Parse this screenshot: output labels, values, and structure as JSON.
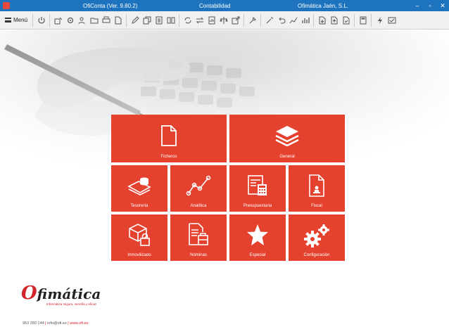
{
  "titlebar": {
    "app": "OfiConta (Ver. 9.80.2)",
    "section": "Contabilidad",
    "company": "Ofimática Jaén, S.L.",
    "min": "–",
    "max": "▫",
    "close": "✕"
  },
  "toolbar": {
    "menu_label": "Menú"
  },
  "tiles": {
    "ficheros": "Ficheros",
    "general": "General",
    "tesoreria": "Tesorería",
    "analitica": "Analítica",
    "presupuestaria": "Presupuestaria",
    "fiscal": "Fiscal",
    "inmovilizado": "Inmovilizado",
    "nominas": "Nóminas",
    "especial": "Especial",
    "configuracion": "Configuración"
  },
  "logo": {
    "o_letter": "O",
    "rest": "fimática",
    "tagline": "Informática segura, sencilla y eficaz"
  },
  "contact": {
    "phone": "953 280 144",
    "email": "info@ofi.es",
    "web": "www.ofi.es",
    "sep": "|"
  },
  "colors": {
    "accent": "#e5412f",
    "titlebar": "#1e73be"
  }
}
